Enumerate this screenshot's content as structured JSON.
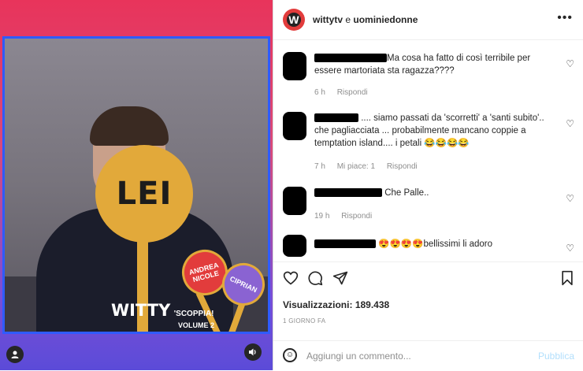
{
  "video": {
    "paddle_main": "LEI",
    "paddle_red": "ANDREA NICOLE",
    "paddle_purple": "CIPRIAN",
    "brand_title": "WITTY",
    "brand_sub": "'SCOPPIA!",
    "brand_volume": "VOLUME 2",
    "left_control_icon": "person-icon",
    "right_control_icon": "volume-icon"
  },
  "post": {
    "author": "wittytv",
    "joiner": "e",
    "coauthor": "uominiedonne",
    "more_icon": "•••",
    "logo_letter": "W"
  },
  "comments": [
    {
      "text": "Ma cosa ha fatto di così terribile per essere martoriata sta ragazza????",
      "time": "6 h",
      "reply": "Rispondi",
      "likes": ""
    },
    {
      "text": ".... siamo passati da 'scorretti' a 'santi subito'.. che pagliacciata ... probabilmente mancano coppie a temptation island.... i petali 😂😂😂😂",
      "time": "7 h",
      "likes": "Mi piace: 1",
      "reply": "Rispondi"
    },
    {
      "text": "Che Palle..",
      "time": "19 h",
      "reply": "Rispondi",
      "likes": ""
    },
    {
      "text": "😍😍😍😍bellissimi li adoro",
      "time": "",
      "reply": "",
      "likes": ""
    }
  ],
  "stats": {
    "views_label": "Visualizzazioni:",
    "views_value": "189.438",
    "date": "1 GIORNO FA"
  },
  "add_comment": {
    "placeholder": "Aggiungi un commento...",
    "publish": "Pubblica"
  }
}
